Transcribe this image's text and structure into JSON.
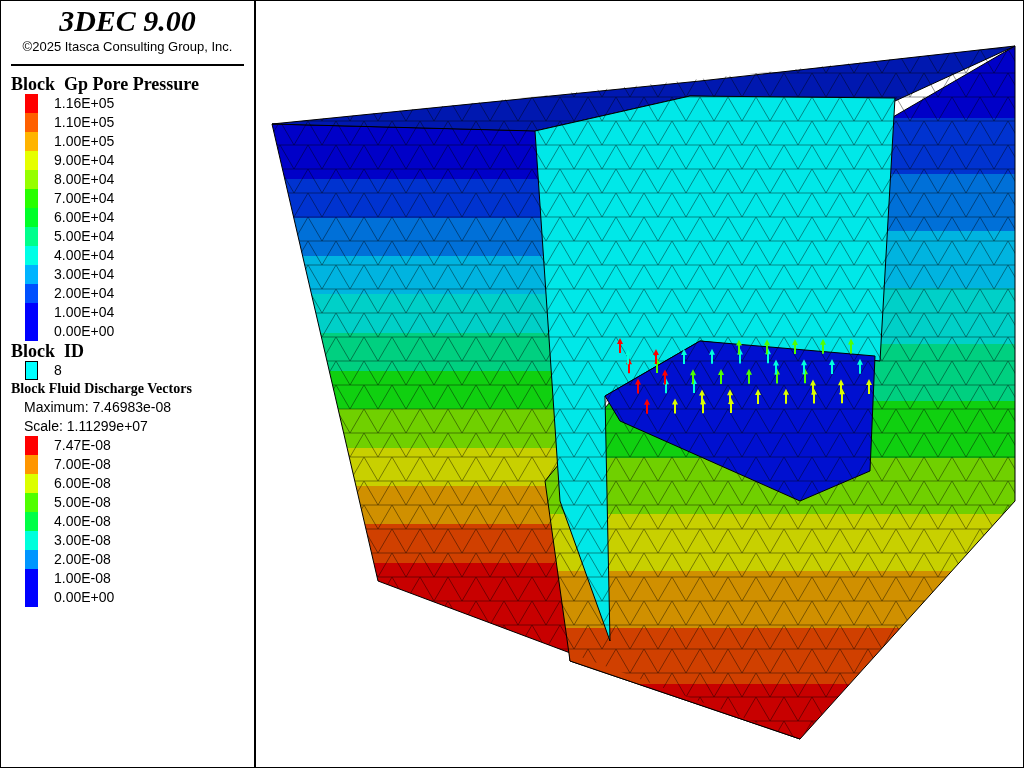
{
  "title": "3DEC 9.00",
  "copyright": "©2025 Itasca Consulting Group, Inc.",
  "legends": [
    {
      "kind": "contour",
      "title": "Block  Gp Pore Pressure",
      "items": [
        {
          "label": "1.16E+05",
          "color": "#ff0000"
        },
        {
          "label": "1.10E+05",
          "color": "#ff6000"
        },
        {
          "label": "1.00E+05",
          "color": "#ffb400"
        },
        {
          "label": "9.00E+04",
          "color": "#e6ff00"
        },
        {
          "label": "8.00E+04",
          "color": "#96ff00"
        },
        {
          "label": "7.00E+04",
          "color": "#28ff00"
        },
        {
          "label": "6.00E+04",
          "color": "#00ff28"
        },
        {
          "label": "5.00E+04",
          "color": "#00ff8c"
        },
        {
          "label": "4.00E+04",
          "color": "#00ffe6"
        },
        {
          "label": "3.00E+04",
          "color": "#00b4ff"
        },
        {
          "label": "2.00E+04",
          "color": "#0050ff"
        },
        {
          "label": "1.00E+04",
          "color": "#0000ff"
        },
        {
          "label": "0.00E+00",
          "color": "#0000ff"
        }
      ]
    },
    {
      "kind": "block_id",
      "title": "Block  ID",
      "items": [
        {
          "label": "8",
          "color": "#00ffff"
        }
      ]
    },
    {
      "kind": "vectors",
      "title": "Block Fluid Discharge Vectors",
      "notes": [
        "Maximum: 7.46983e-08",
        "Scale: 1.11299e+07"
      ],
      "items": [
        {
          "label": "7.47E-08",
          "color": "#ff0000"
        },
        {
          "label": "7.00E-08",
          "color": "#ff9600"
        },
        {
          "label": "6.00E-08",
          "color": "#dcff00"
        },
        {
          "label": "5.00E-08",
          "color": "#50ff00"
        },
        {
          "label": "4.00E-08",
          "color": "#00ff46"
        },
        {
          "label": "3.00E-08",
          "color": "#00ffdc"
        },
        {
          "label": "2.00E-08",
          "color": "#0096ff"
        },
        {
          "label": "1.00E-08",
          "color": "#0000ff"
        },
        {
          "label": "0.00E+00",
          "color": "#0000ff"
        }
      ]
    }
  ]
}
